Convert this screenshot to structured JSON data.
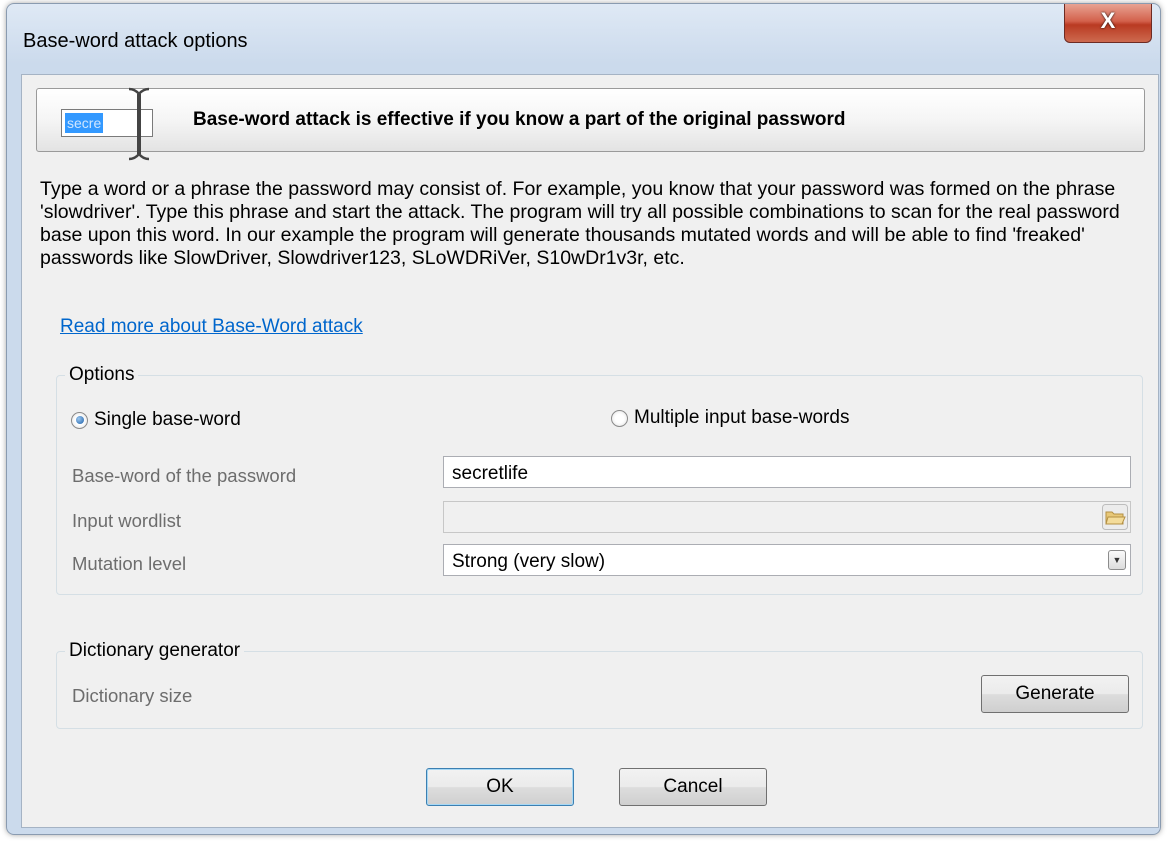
{
  "window": {
    "title": "Base-word attack options",
    "close_glyph": "X"
  },
  "banner": {
    "field_text": "secre",
    "heading": "Base-word attack is effective if you know a part of the original password",
    "cursor_icon": "text-cursor-icon"
  },
  "description": "Type a word or a phrase the password may consist of. For example, you know that your password was formed on the phrase 'slowdriver'. Type this phrase and start the attack. The program will try all possible combinations to scan for the real password base upon this word. In our example the program will generate thousands mutated words and will be able to find 'freaked' passwords like SlowDriver, Slowdriver123, SLoWDRiVer, S10wDr1v3r, etc.",
  "link": "Read more about Base-Word attack",
  "options": {
    "label": "Options",
    "single_label": "Single base-word",
    "multiple_label": "Multiple input base-words",
    "selected": "single",
    "baseword_label": "Base-word of the password",
    "baseword_value": "secretlife",
    "wordlist_label": "Input wordlist",
    "wordlist_value": "",
    "mutation_label": "Mutation level",
    "mutation_value": "Strong (very slow)",
    "folder_icon": "folder-open-icon",
    "dropdown_icon": "chevron-down-icon"
  },
  "generator": {
    "label": "Dictionary generator",
    "size_label": "Dictionary size",
    "generate_label": "Generate"
  },
  "buttons": {
    "ok": "OK",
    "cancel": "Cancel"
  },
  "colors": {
    "link": "#0066cc",
    "selection": "#3399ff",
    "close_button": "#c8462f"
  }
}
